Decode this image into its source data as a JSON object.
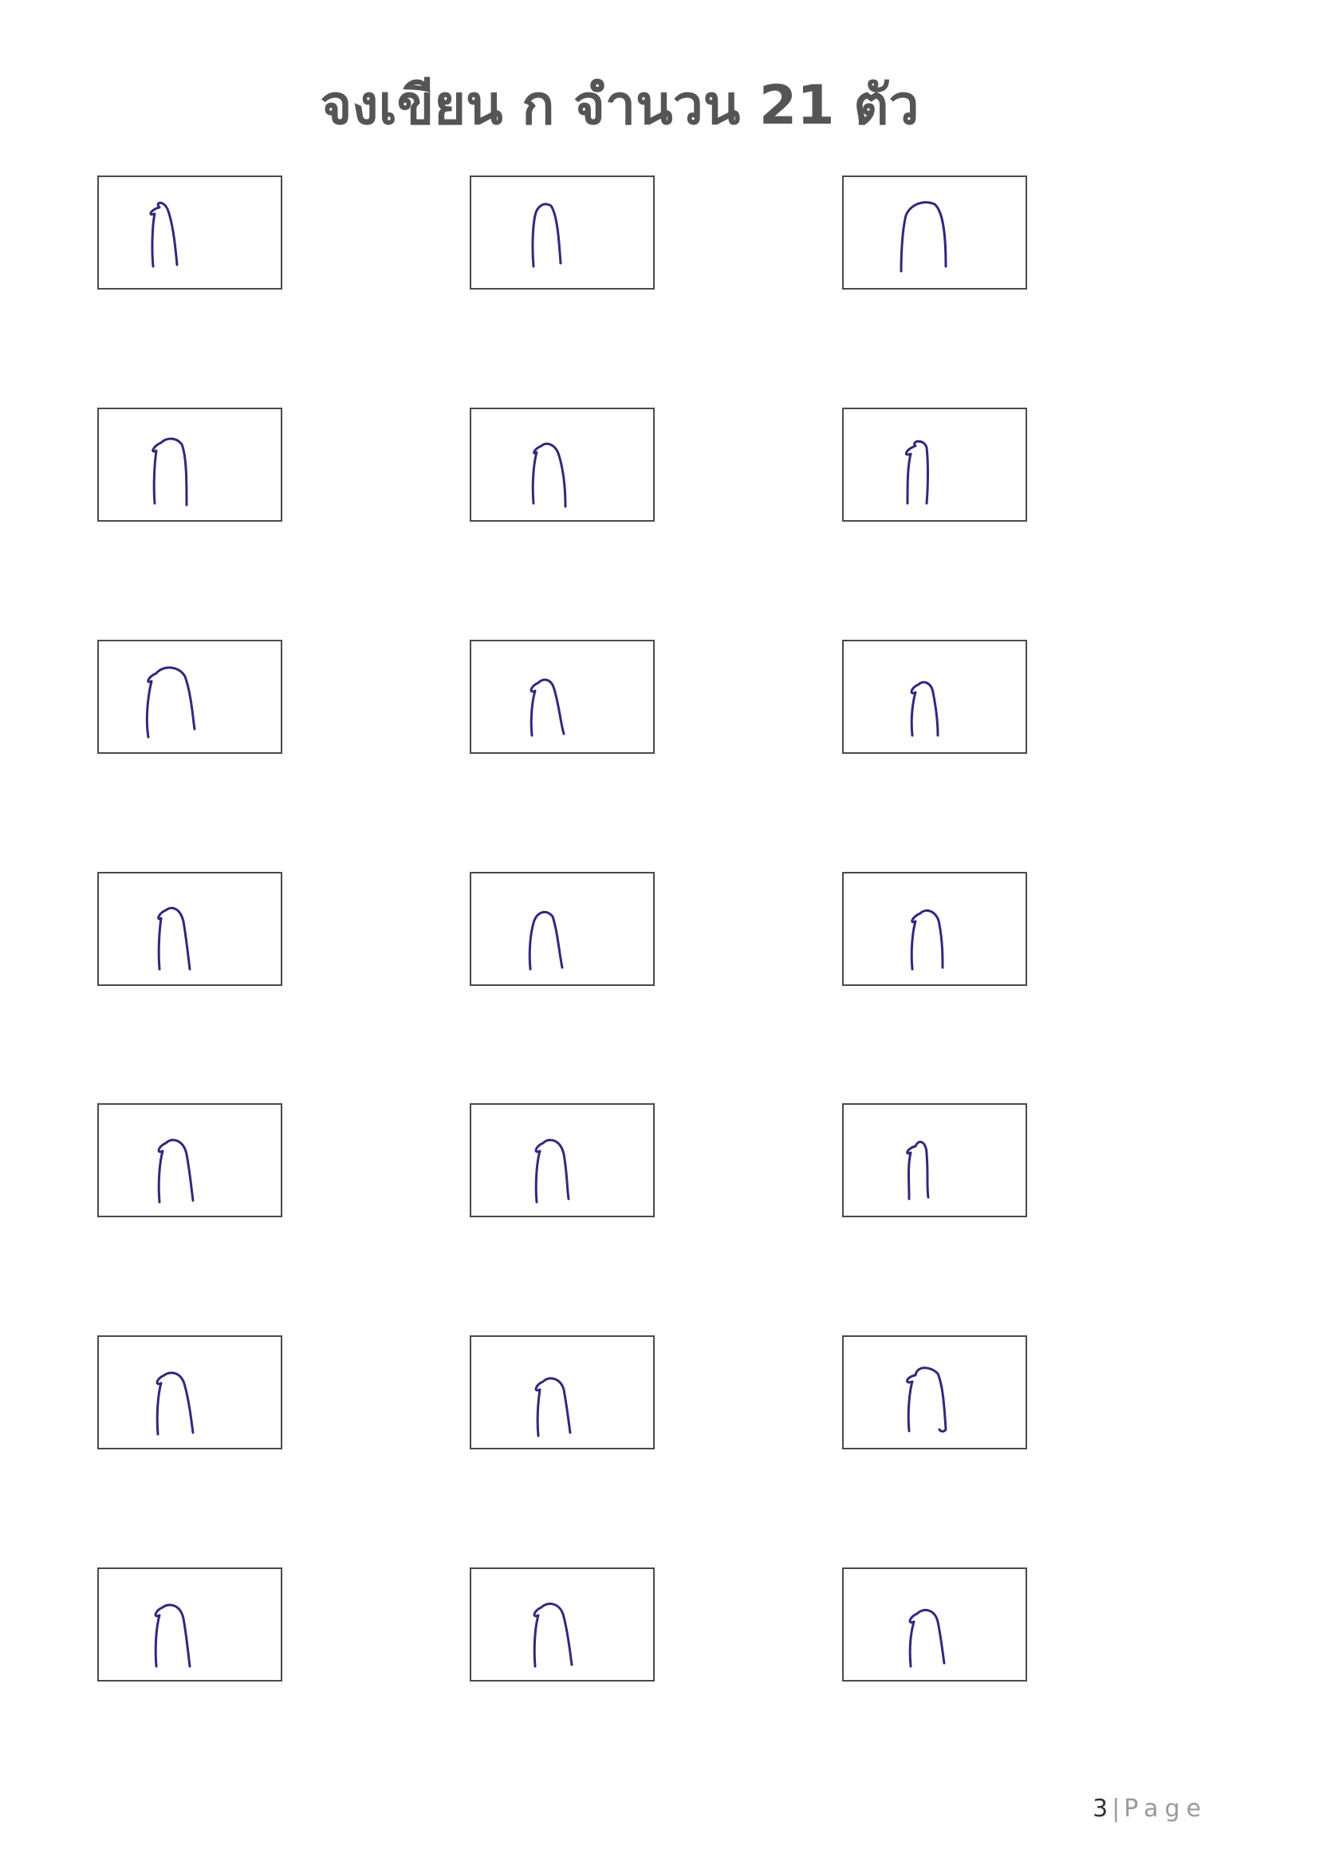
{
  "worksheet": {
    "title": "จงเขียน ก จำนวน 21 ตัว",
    "cells": [
      {
        "row": 1,
        "col": 1
      },
      {
        "row": 1,
        "col": 2
      },
      {
        "row": 1,
        "col": 3
      },
      {
        "row": 2,
        "col": 1
      },
      {
        "row": 2,
        "col": 2
      },
      {
        "row": 2,
        "col": 3
      },
      {
        "row": 3,
        "col": 1
      },
      {
        "row": 3,
        "col": 2
      },
      {
        "row": 3,
        "col": 3
      },
      {
        "row": 4,
        "col": 1
      },
      {
        "row": 4,
        "col": 2
      },
      {
        "row": 4,
        "col": 3
      },
      {
        "row": 5,
        "col": 1
      },
      {
        "row": 5,
        "col": 2
      },
      {
        "row": 5,
        "col": 3
      },
      {
        "row": 6,
        "col": 1
      },
      {
        "row": 6,
        "col": 2
      },
      {
        "row": 6,
        "col": 3
      },
      {
        "row": 7,
        "col": 1
      },
      {
        "row": 7,
        "col": 2
      },
      {
        "row": 7,
        "col": 3
      }
    ],
    "ink_color": "#2f2a7a",
    "box_border_color": "#4a4a4a"
  },
  "footer": {
    "page_number": "3",
    "separator": "|",
    "page_word": "Page"
  }
}
